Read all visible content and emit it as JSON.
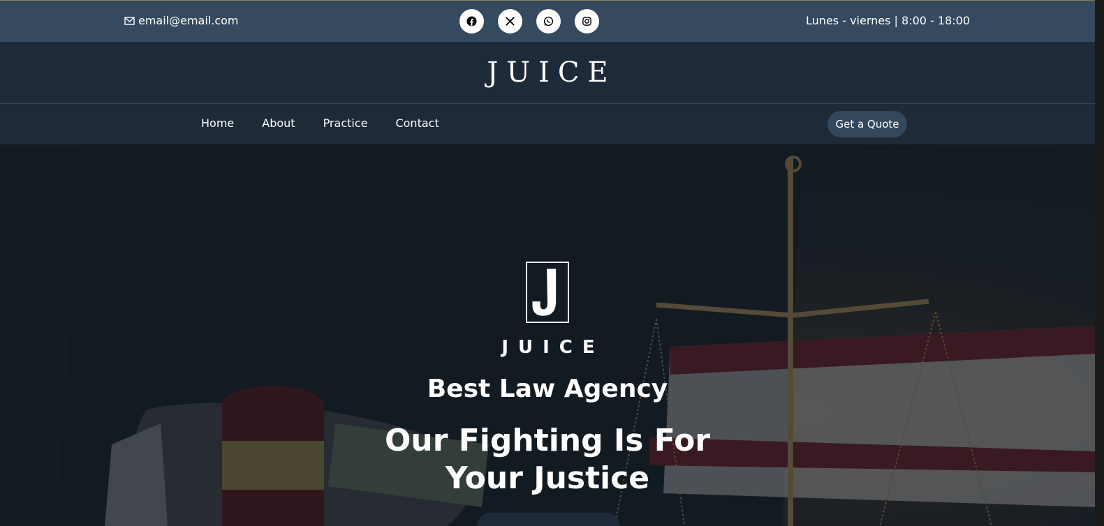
{
  "topbar": {
    "email": "email@email.com",
    "hours": "Lunes - viernes | 8:00 - 18:00",
    "socials": [
      "facebook-icon",
      "x-twitter-icon",
      "whatsapp-icon",
      "instagram-icon"
    ]
  },
  "header": {
    "brand": "JUICE"
  },
  "nav": {
    "items": [
      "Home",
      "About",
      "Practice",
      "Contact"
    ],
    "cta": "Get a Quote"
  },
  "hero": {
    "logo_letter": "J",
    "brand": "JUICE",
    "subtitle": "Best Law Agency",
    "title_line1": "Our Fighting Is For",
    "title_line2": "Your Justice"
  },
  "colors": {
    "topbar": "#35495f",
    "header": "#1e2a38",
    "cta": "#34475d"
  }
}
